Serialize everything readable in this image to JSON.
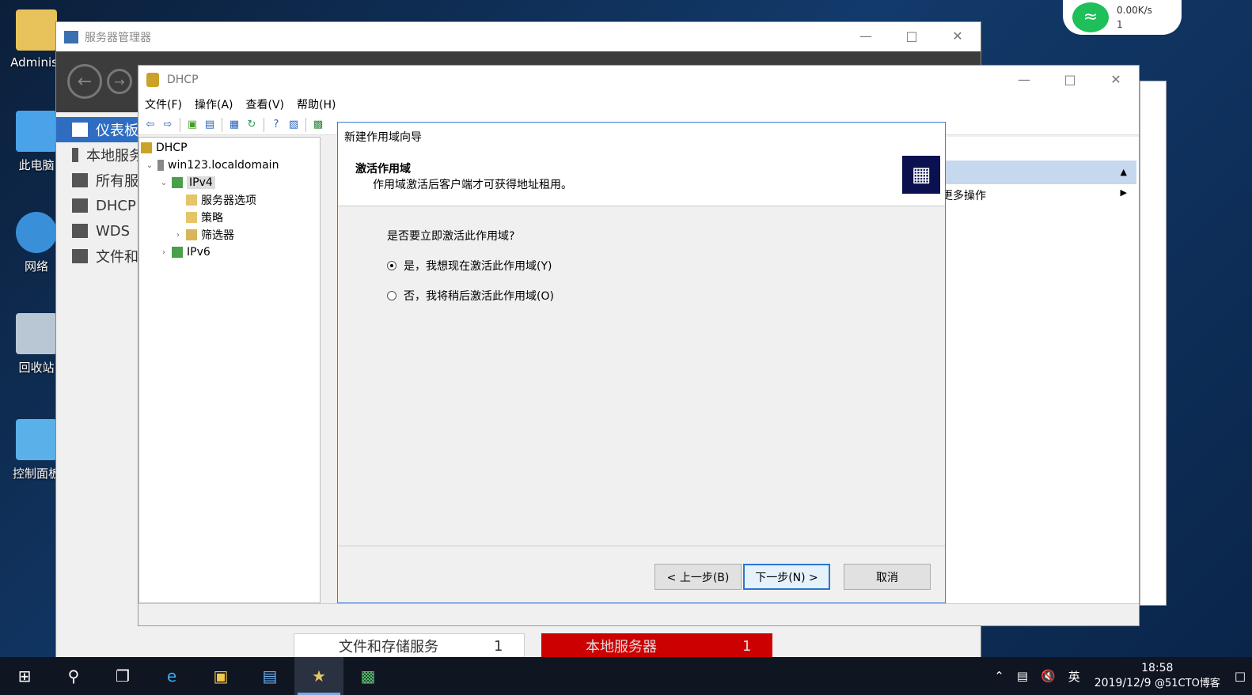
{
  "desktop": {
    "icons": [
      {
        "label": "Administ"
      },
      {
        "label": "此电脑"
      },
      {
        "label": "网络"
      },
      {
        "label": "回收站"
      },
      {
        "label": "控制面板"
      }
    ]
  },
  "widget": {
    "speed": "0.00K/s",
    "count": "1"
  },
  "server_manager": {
    "title": "服务器管理器",
    "sidebar": [
      {
        "label": "仪表板",
        "active": true
      },
      {
        "label": "本地服务器"
      },
      {
        "label": "所有服务器"
      },
      {
        "label": "DHCP"
      },
      {
        "label": "WDS"
      },
      {
        "label": "文件和存储服务"
      }
    ],
    "tiles": [
      {
        "label": "文件和存储服务",
        "count": "1"
      },
      {
        "label": "本地服务器",
        "count": "1"
      }
    ]
  },
  "dhcp": {
    "title": "DHCP",
    "menu": [
      "文件(F)",
      "操作(A)",
      "查看(V)",
      "帮助(H)"
    ],
    "tree": {
      "root": "DHCP",
      "server": "win123.localdomain",
      "ipv4": "IPv4",
      "server_options": "服务器选项",
      "policies": "策略",
      "filters": "筛选器",
      "ipv6": "IPv6"
    },
    "actions": {
      "more": "更多操作"
    }
  },
  "wizard": {
    "caption": "新建作用域向导",
    "heading": "激活作用域",
    "subheading": "作用域激活后客户端才可获得地址租用。",
    "question": "是否要立即激活此作用域?",
    "options": [
      {
        "label": "是，我想现在激活此作用域(Y)",
        "selected": true
      },
      {
        "label": "否，我将稍后激活此作用域(O)",
        "selected": false
      }
    ],
    "buttons": {
      "back": "< 上一步(B)",
      "next": "下一步(N) >",
      "cancel": "取消"
    }
  },
  "taskbar": {
    "tray_ime": "英",
    "time": "18:58",
    "date": "2019/12/9",
    "watermark": "@51CTO博客"
  }
}
